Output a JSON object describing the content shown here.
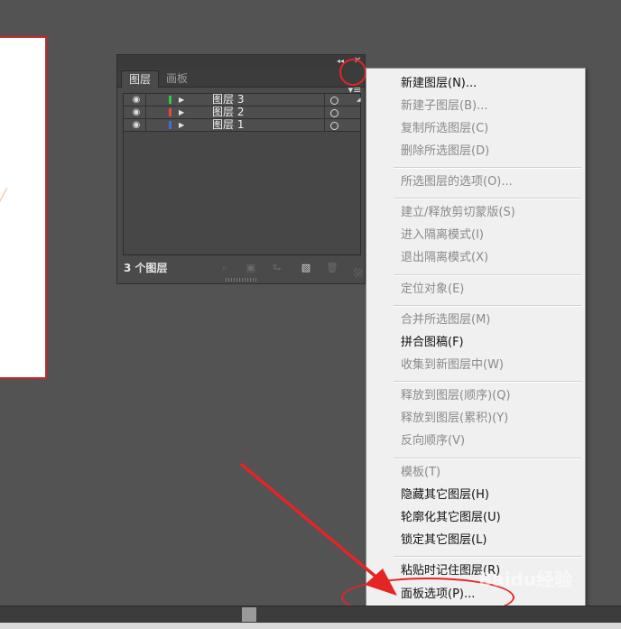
{
  "panel": {
    "tabs": [
      "图层",
      "画板"
    ],
    "layers": [
      {
        "name": "图层 3",
        "color": "#2ecc40"
      },
      {
        "name": "图层 2",
        "color": "#e74c3c"
      },
      {
        "name": "图层 1",
        "color": "#3b6fd8"
      }
    ],
    "layer_count": "3 个图层"
  },
  "menu": {
    "items": [
      {
        "label": "新建图层(N)...",
        "enabled": true
      },
      {
        "label": "新建子图层(B)...",
        "enabled": false
      },
      {
        "label": "复制所选图层(C)",
        "enabled": false
      },
      {
        "label": "删除所选图层(D)",
        "enabled": false
      },
      {
        "label": "所选图层的选项(O)...",
        "enabled": false
      },
      {
        "label": "建立/释放剪切蒙版(S)",
        "enabled": false
      },
      {
        "label": "进入隔离模式(I)",
        "enabled": false
      },
      {
        "label": "退出隔离模式(X)",
        "enabled": false
      },
      {
        "label": "定位对象(E)",
        "enabled": false
      },
      {
        "label": "合并所选图层(M)",
        "enabled": false
      },
      {
        "label": "拼合图稿(F)",
        "enabled": true
      },
      {
        "label": "收集到新图层中(W)",
        "enabled": false
      },
      {
        "label": "释放到图层(顺序)(Q)",
        "enabled": false
      },
      {
        "label": "释放到图层(累积)(Y)",
        "enabled": false
      },
      {
        "label": "反向顺序(V)",
        "enabled": false
      },
      {
        "label": "模板(T)",
        "enabled": false
      },
      {
        "label": "隐藏其它图层(H)",
        "enabled": true
      },
      {
        "label": "轮廓化其它图层(U)",
        "enabled": true
      },
      {
        "label": "锁定其它图层(L)",
        "enabled": true
      },
      {
        "label": "粘贴时记住图层(R)",
        "enabled": true
      },
      {
        "label": "面板选项(P)...",
        "enabled": true
      }
    ]
  },
  "watermark": "Baidu经验",
  "colors": {
    "annotation": "#e52424",
    "menu_bg": "#f0f0f0",
    "app_bg": "#535353"
  },
  "icons": [
    "eye-icon",
    "disclosure-triangle-icon",
    "target-circle-icon",
    "panel-menu-icon",
    "locate-object-icon",
    "make-clipping-mask-icon",
    "new-sublayer-icon",
    "new-layer-icon",
    "trash-icon"
  ]
}
